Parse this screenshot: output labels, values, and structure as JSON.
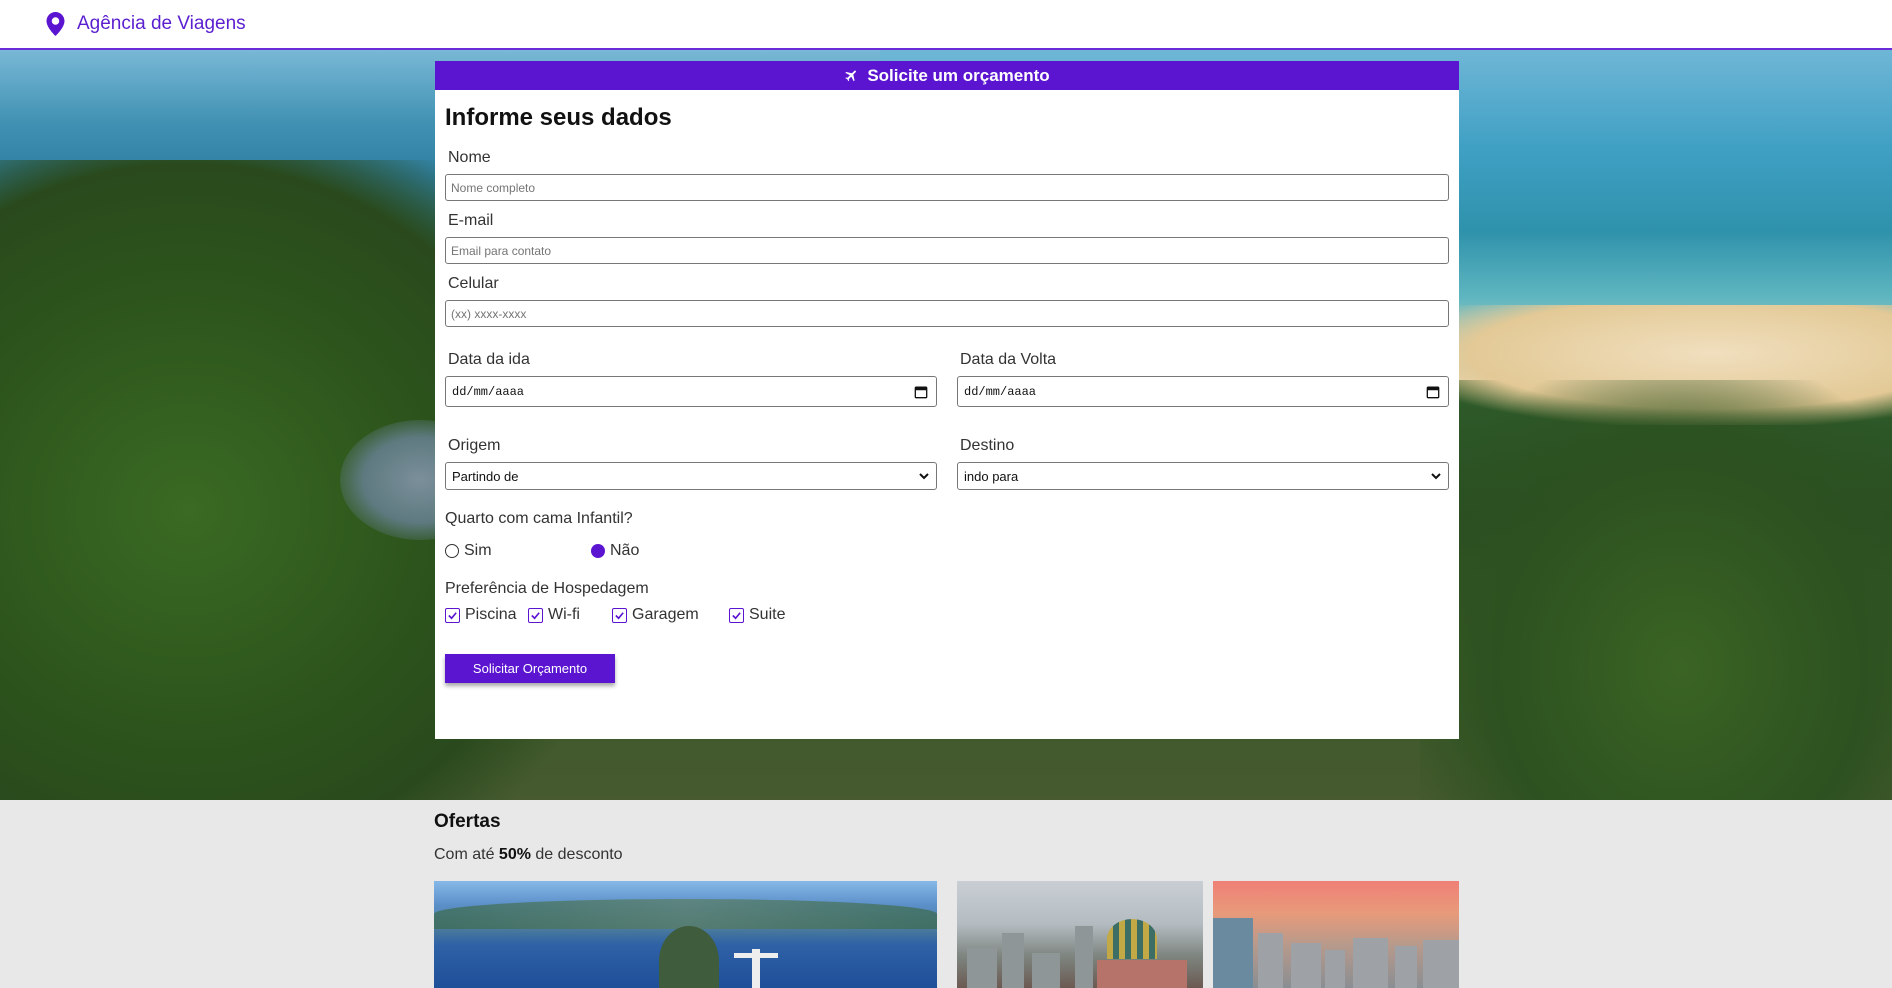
{
  "header": {
    "brand": "Agência de Viagens",
    "brand_icon": "map-pin-icon",
    "accent_color": "#5b14d0"
  },
  "form": {
    "banner": "Solicite um orçamento",
    "banner_icon": "plane-icon",
    "title": "Informe seus dados",
    "name_label": "Nome",
    "name_placeholder": "Nome completo",
    "email_label": "E-mail",
    "email_placeholder": "Email para contato",
    "phone_label": "Celular",
    "phone_placeholder": "(xx) xxxx-xxxx",
    "departure_label": "Data da ida",
    "departure_value": "dd/mm/aaaa",
    "return_label": "Data da Volta",
    "return_value": "dd/mm/aaaa",
    "origin_label": "Origem",
    "origin_selected": "Partindo de",
    "destination_label": "Destino",
    "destination_selected": "indo para",
    "crib_question": "Quarto com cama Infantil?",
    "crib_options": [
      {
        "label": "Sim",
        "selected": false
      },
      {
        "label": "Não",
        "selected": true
      }
    ],
    "prefs_label": "Preferência de Hospedagem",
    "prefs": [
      {
        "label": "Piscina",
        "checked": true
      },
      {
        "label": "Wi-fi",
        "checked": true
      },
      {
        "label": "Garagem",
        "checked": true
      },
      {
        "label": "Suite",
        "checked": true
      }
    ],
    "submit_label": "Solicitar Orçamento"
  },
  "offers": {
    "title": "Ofertas",
    "subtitle_prefix": "Com até ",
    "subtitle_bold": "50%",
    "subtitle_suffix": " de desconto"
  }
}
